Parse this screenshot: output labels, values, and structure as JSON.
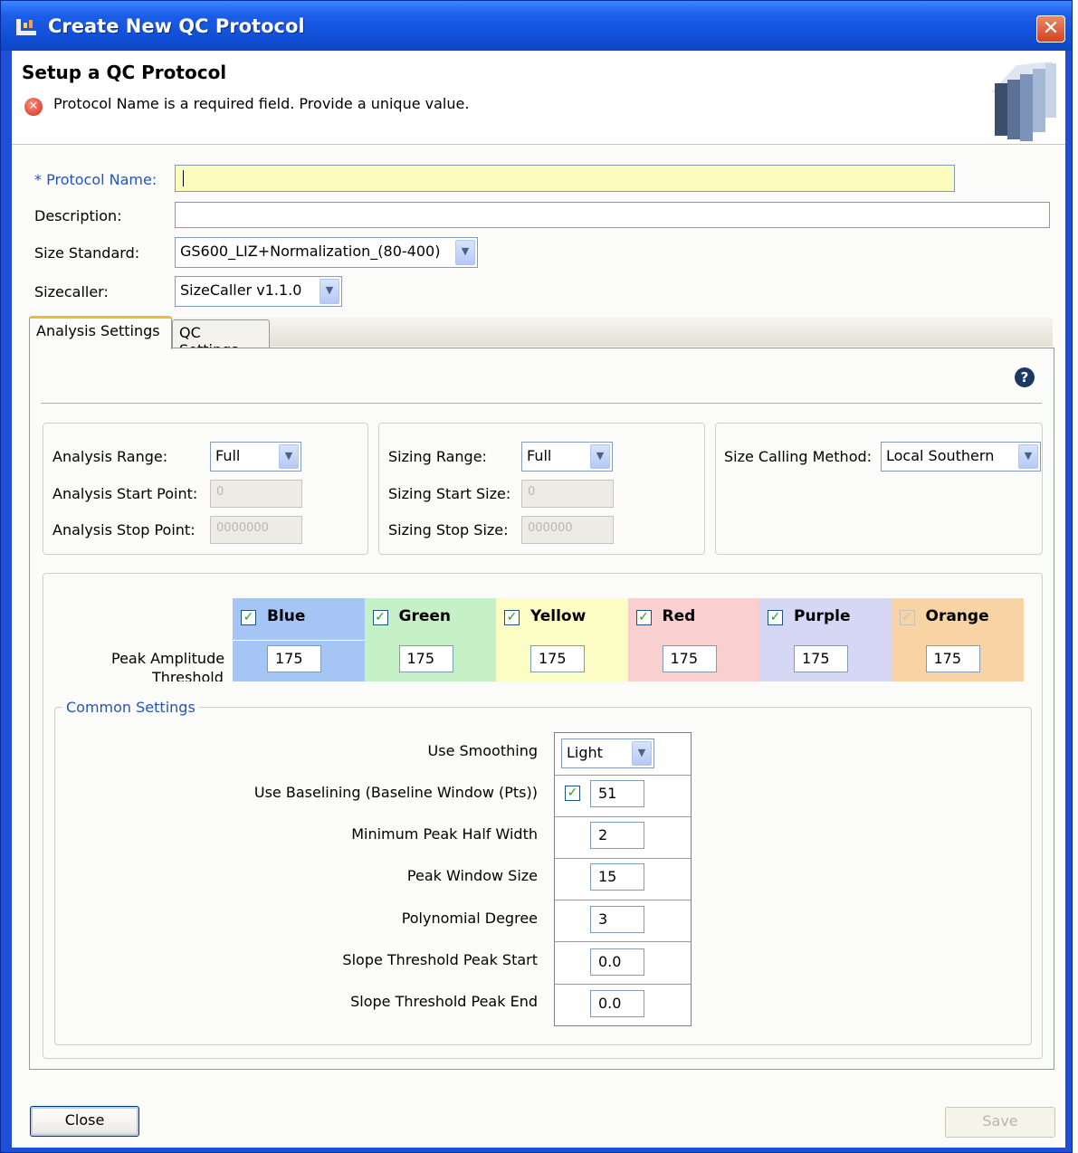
{
  "window": {
    "title": "Create New QC Protocol",
    "close_glyph": "✕"
  },
  "header": {
    "title": "Setup a QC Protocol",
    "error_message": "Protocol Name is a required field. Provide a unique value."
  },
  "form": {
    "protocol_name": {
      "required_marker": "*",
      "label": "Protocol Name:",
      "value": ""
    },
    "description": {
      "label": "Description:",
      "value": ""
    },
    "size_standard": {
      "label": "Size Standard:",
      "value": "GS600_LIZ+Normalization_(80-400)"
    },
    "sizecaller": {
      "label": "Sizecaller:",
      "value": "SizeCaller v1.1.0"
    }
  },
  "tabs": [
    {
      "label": "Analysis Settings",
      "active": true
    },
    {
      "label": "QC Settings",
      "active": false
    }
  ],
  "analysis": {
    "range": {
      "label": "Analysis Range:",
      "value": "Full"
    },
    "start": {
      "label": "Analysis Start Point:",
      "value": "0"
    },
    "stop": {
      "label": "Analysis Stop Point:",
      "value": "0000000"
    },
    "sizing_range": {
      "label": "Sizing Range:",
      "value": "Full"
    },
    "sizing_start": {
      "label": "Sizing Start Size:",
      "value": "0"
    },
    "sizing_stop": {
      "label": "Sizing Stop Size:",
      "value": "000000"
    },
    "method": {
      "label": "Size Calling Method:",
      "value": "Local Southern"
    }
  },
  "dyes": {
    "row_label_1": "Peak Amplitude",
    "row_label_2": "Threshold",
    "items": [
      {
        "name": "Blue",
        "checked": true,
        "value": "175",
        "color": "#a5c6f4"
      },
      {
        "name": "Green",
        "checked": true,
        "value": "175",
        "color": "#c6f0c5"
      },
      {
        "name": "Yellow",
        "checked": true,
        "value": "175",
        "color": "#fcfcc5"
      },
      {
        "name": "Red",
        "checked": true,
        "value": "175",
        "color": "#f9cfcf"
      },
      {
        "name": "Purple",
        "checked": true,
        "value": "175",
        "color": "#d6d7f4"
      },
      {
        "name": "Orange",
        "checked": true,
        "value": "175",
        "color": "#f8d3a4"
      }
    ]
  },
  "common": {
    "title": "Common Settings",
    "smoothing": {
      "label": "Use Smoothing",
      "value": "Light"
    },
    "baselining": {
      "label": "Use Baselining (Baseline Window (Pts))",
      "value": "51"
    },
    "min_half_width": {
      "label": "Minimum Peak Half Width",
      "value": "2"
    },
    "window_size": {
      "label": "Peak Window Size",
      "value": "15"
    },
    "poly_degree": {
      "label": "Polynomial Degree",
      "value": "3"
    },
    "slope_start": {
      "label": "Slope Threshold Peak Start",
      "value": "0.0"
    },
    "slope_end": {
      "label": "Slope Threshold Peak End",
      "value": "0.0"
    }
  },
  "buttons": {
    "close": "Close",
    "save": "Save"
  }
}
